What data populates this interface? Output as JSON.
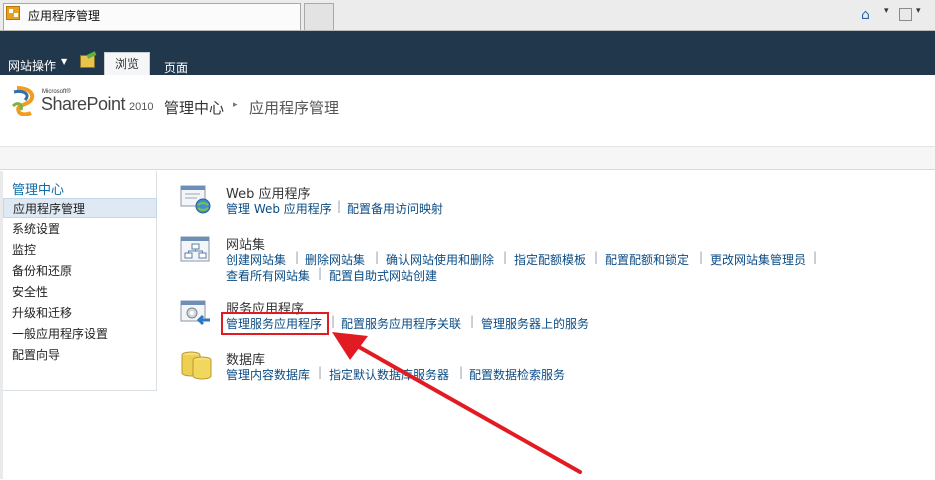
{
  "browser": {
    "tab_title": "应用程序管理",
    "icons": [
      "favicon-sharepoint-icon",
      "home-icon",
      "feed-icon",
      "dropdown-arrow-icon"
    ]
  },
  "ribbon": {
    "site_actions": "网站操作",
    "tabs": [
      {
        "label": "浏览",
        "selected": true
      },
      {
        "label": "页面",
        "selected": false
      }
    ],
    "colors": {
      "background": "#21374c",
      "selected_tab": "#f4f6f8"
    }
  },
  "logo": {
    "microsoft": "Microsoft®",
    "product": "SharePoint",
    "year": "2010"
  },
  "breadcrumb": {
    "home": "管理中心",
    "separator": "▸",
    "current": "应用程序管理"
  },
  "leftnav": {
    "heading": "管理中心",
    "items": [
      {
        "label": "应用程序管理",
        "selected": true
      },
      {
        "label": "系统设置"
      },
      {
        "label": "监控"
      },
      {
        "label": "备份和还原"
      },
      {
        "label": "安全性"
      },
      {
        "label": "升级和迁移"
      },
      {
        "label": "一般应用程序设置"
      },
      {
        "label": "配置向导"
      }
    ]
  },
  "groups": [
    {
      "title": "Web 应用程序",
      "icon": "web-application-icon",
      "links": [
        "管理 Web 应用程序",
        "配置备用访问映射"
      ]
    },
    {
      "title": "网站集",
      "icon": "site-collection-icon",
      "links": [
        "创建网站集",
        "删除网站集",
        "确认网站使用和删除",
        "指定配额模板",
        "配置配额和锁定",
        "更改网站集管理员",
        "查看所有网站集",
        "配置自助式网站创建"
      ]
    },
    {
      "title": "服务应用程序",
      "icon": "service-application-icon",
      "links": [
        "管理服务应用程序",
        "配置服务应用程序关联",
        "管理服务器上的服务"
      ]
    },
    {
      "title": "数据库",
      "icon": "database-icon",
      "links": [
        "管理内容数据库",
        "指定默认数据库服务器",
        "配置数据检索服务"
      ]
    }
  ],
  "annotation": {
    "highlighted_link": "管理服务应用程序",
    "color": "#e21b23"
  }
}
